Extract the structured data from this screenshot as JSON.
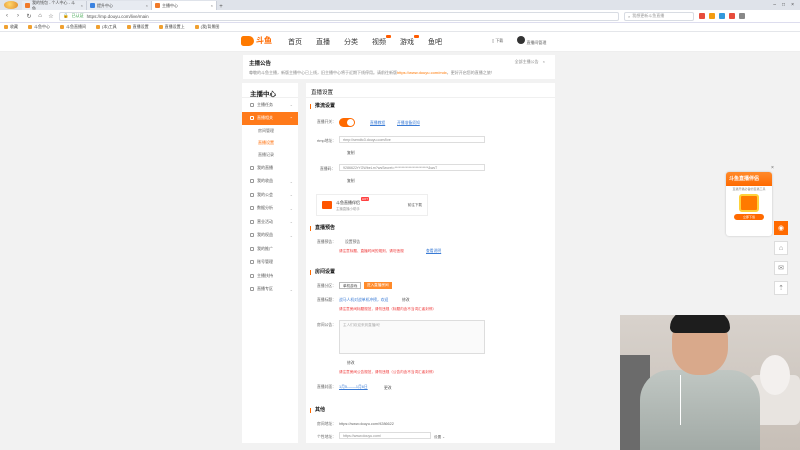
{
  "browser": {
    "tabs": [
      {
        "label": "我的钱包 - 个人中心 - 斗鱼",
        "active": false
      },
      {
        "label": "提升中心",
        "active": false
      },
      {
        "label": "主播中心",
        "active": true
      }
    ],
    "url": "https://mp.douyu.com/live/main",
    "url_verified": "已认证",
    "search_placeholder": "我想更新斗鱼直播",
    "bookmarks": [
      "收藏",
      "斗鱼中心",
      "斗鱼直播间",
      "(本)工具",
      "直播设置",
      "直播设置上",
      "(我)背景图"
    ]
  },
  "site": {
    "logo_text": "斗鱼",
    "nav": [
      "首页",
      "直播",
      "分类",
      "视频",
      "游戏",
      "鱼吧"
    ],
    "download_label": "下载",
    "username": "直播间管理"
  },
  "notice": {
    "title": "主播公告",
    "text": "尊敬的斗鱼主播，新版主播中心已上线，旧主播中心将于近期下线停用。请前往新版",
    "link": "https://www.douyu.com/mdx",
    "text_after": "，更好开启您的直播之旅！",
    "action": "全部主播公告",
    "close": "×"
  },
  "sidebar": {
    "title": "主播中心",
    "items": [
      {
        "label": "主播任务",
        "active": false
      },
      {
        "label": "直播相关",
        "active": true
      },
      {
        "label": "我的直播",
        "active": false
      },
      {
        "label": "我的收益",
        "active": false
      },
      {
        "label": "我的公会",
        "active": false
      },
      {
        "label": "数据分析",
        "active": false
      },
      {
        "label": "营业活动",
        "active": false
      },
      {
        "label": "我的权益",
        "active": false
      },
      {
        "label": "我的推广",
        "active": false
      },
      {
        "label": "账号管理",
        "active": false
      },
      {
        "label": "主播扶持",
        "active": false
      },
      {
        "label": "直播专区",
        "active": false
      }
    ],
    "subitems": [
      {
        "label": "房间管理",
        "active": false
      },
      {
        "label": "直播设置",
        "active": true
      },
      {
        "label": "直播记录",
        "active": false
      }
    ]
  },
  "main": {
    "page_title": "直播设置",
    "push": {
      "heading": "推流设置",
      "live_switch_label": "直播开关：",
      "tutorial_link": "直播教程",
      "obs_link": "开播准备须知",
      "rtmp_label": "rtmp地址：",
      "rtmp_value": "rtmp://sendtc3.douyu.com/live",
      "copy1": "复制",
      "code_label": "直播码：",
      "code_value": "9286622rYGWbeLm?wsSecret=************************&wsT",
      "copy2": "复制"
    },
    "promo": {
      "title": "斗鱼直播伴侣",
      "subtitle": "主播直播小助手",
      "hot": "HOT",
      "button": "前往下载"
    },
    "preview": {
      "heading": "直播预告",
      "label": "直播预告：",
      "value": "设置预告",
      "warning": "请注意标题、直播时间的规则，请勿违规",
      "link": "查看说明"
    },
    "room": {
      "heading": "房间设置",
      "category_label": "直播分区：",
      "category_value": "单机游戏",
      "category_button": "进入直播房间",
      "title_label": "直播标题：",
      "title_value": "战马人机对战单机冲榜，欢迎",
      "title_edit": "修改",
      "title_warning": "请注意房间标题规范，请勿违规（标题内含不当词汇者封停）",
      "notice_label": "房间公告：",
      "notice_placeholder": "主人们欢迎来到直播间！",
      "notice_save": "修改",
      "notice_warning": "请注意房间公告规范，请勿违规（公告内含不当词汇者封停）",
      "cover_label": "直播封面：",
      "cover_link": "1月5-——1月6日",
      "cover_edit": "更改"
    },
    "other": {
      "heading": "其他",
      "room_link_label": "房间地址：",
      "room_link_value": "https://www.douyu.com/9286622",
      "custom_label": "个性地址：",
      "custom_value": "https://www.douyu.com/",
      "custom_select": "设置"
    }
  },
  "float": {
    "title": "斗鱼直播伴侣",
    "subtitle": "直播开播必备的直播工具",
    "button": "立即下载",
    "close": "×"
  },
  "colors": {
    "accent": "#ff6a00",
    "link": "#3a7bd5",
    "warning": "#ee3333"
  }
}
